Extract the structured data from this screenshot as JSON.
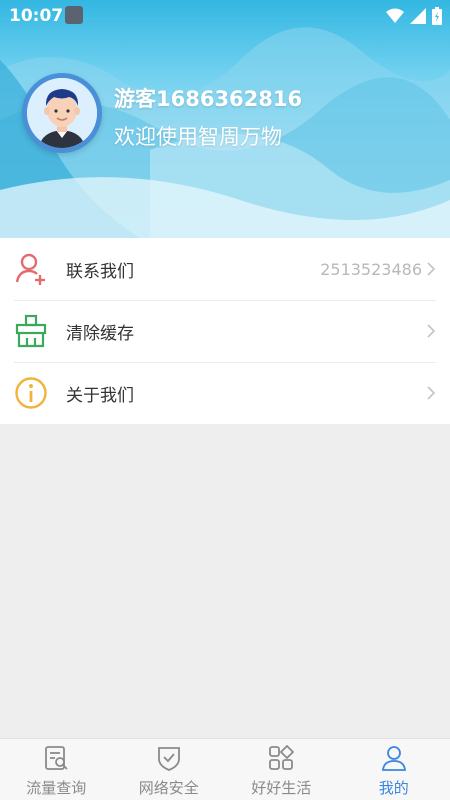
{
  "status_bar": {
    "time": "10:07"
  },
  "profile": {
    "username": "游客1686362816",
    "welcome": "欢迎使用智周万物"
  },
  "menu": {
    "items": [
      {
        "label": "联系我们",
        "value": "2513523486",
        "icon": "add-contact-icon",
        "color": "#e46a6f"
      },
      {
        "label": "清除缓存",
        "value": "",
        "icon": "broom-icon",
        "color": "#3aaa5a"
      },
      {
        "label": "关于我们",
        "value": "",
        "icon": "info-icon",
        "color": "#f0b43c"
      }
    ]
  },
  "bottom_nav": {
    "tabs": [
      {
        "label": "流量查询",
        "icon": "traffic-query-icon"
      },
      {
        "label": "网络安全",
        "icon": "shield-check-icon"
      },
      {
        "label": "好好生活",
        "icon": "apps-grid-icon"
      },
      {
        "label": "我的",
        "icon": "user-icon",
        "active": true
      }
    ],
    "active_color": "#3a86e0"
  }
}
